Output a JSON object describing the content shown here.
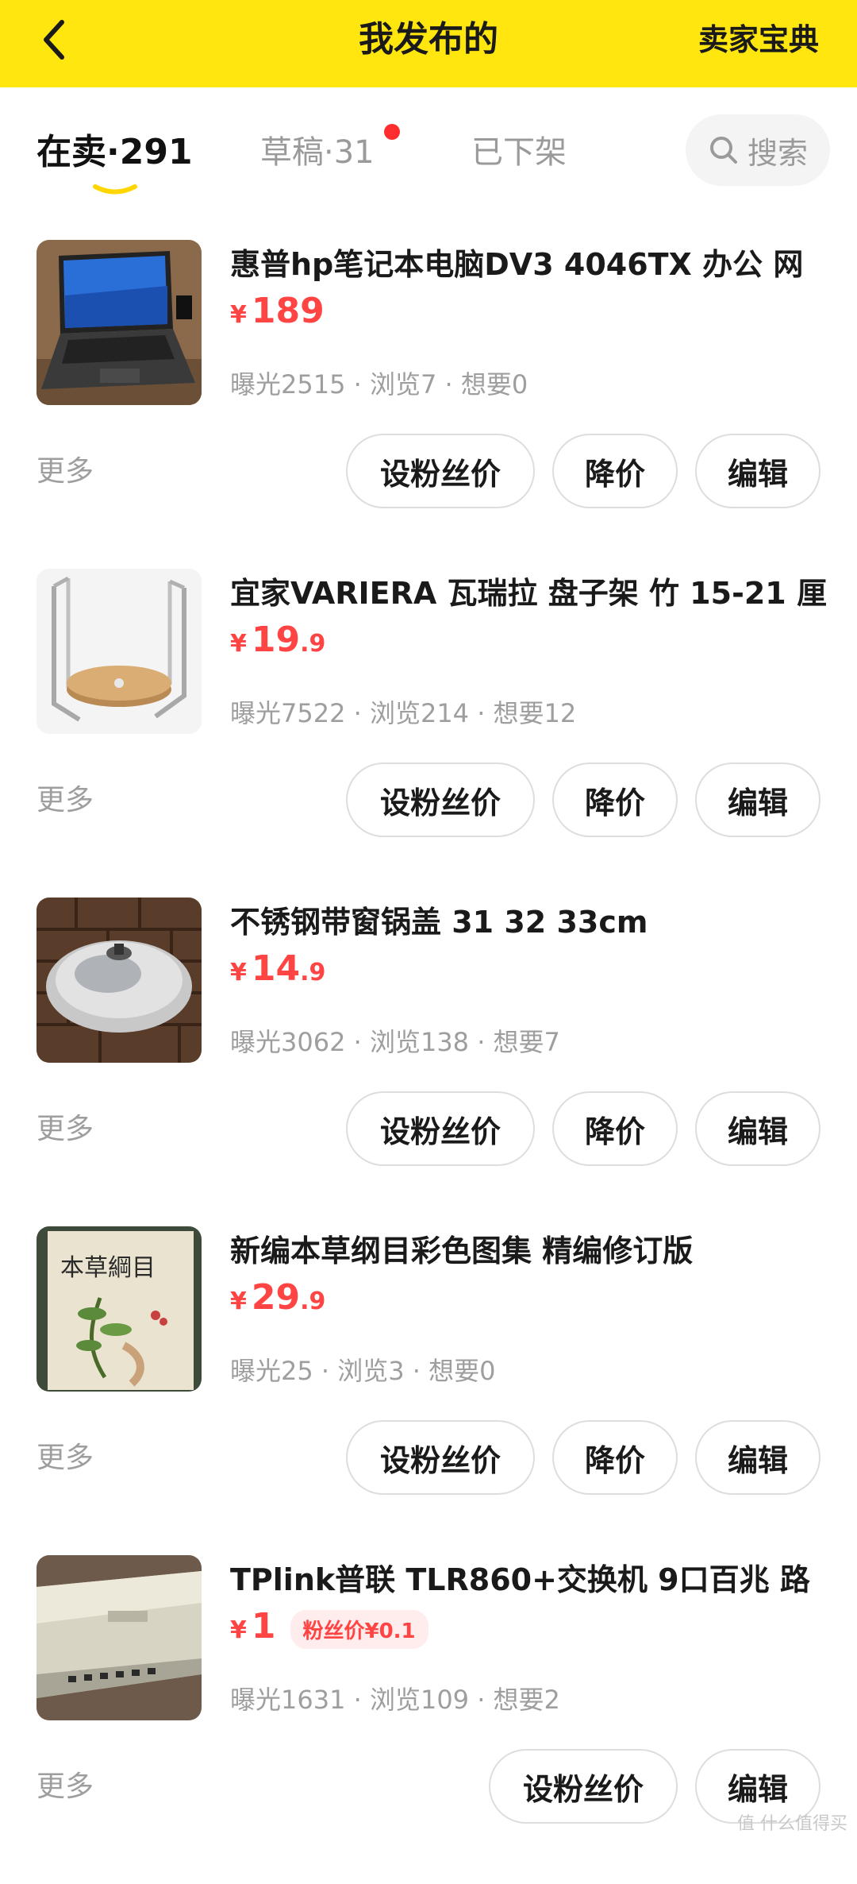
{
  "header": {
    "title": "我发布的",
    "right_link": "卖家宝典",
    "bg_color": "#FFE60F",
    "back_icon": "chevron-left-icon"
  },
  "tabs": {
    "on_sale": "在卖·291",
    "drafts": "草稿·31",
    "off_shelf": "已下架",
    "search_label": "搜索"
  },
  "colors": {
    "price": "#FF4444",
    "dot": "#FF2D2D"
  },
  "items": [
    {
      "title": "惠普hp笔记本电脑DV3 4046TX 办公 网",
      "price_int": "189",
      "price_dec": "",
      "stats": "曝光2515 · 浏览7 · 想要0",
      "more": "更多",
      "btn_fans": "设粉丝价",
      "btn_drop": "降价",
      "btn_edit": "编辑"
    },
    {
      "title": "宜家VARIERA 瓦瑞拉 盘子架 竹 15-21 厘",
      "price_int": "19",
      "price_dec": ".9",
      "stats": "曝光7522 · 浏览214 · 想要12",
      "more": "更多",
      "btn_fans": "设粉丝价",
      "btn_drop": "降价",
      "btn_edit": "编辑"
    },
    {
      "title": "不锈钢带窗锅盖 31 32 33cm",
      "price_int": "14",
      "price_dec": ".9",
      "stats": "曝光3062 · 浏览138 · 想要7",
      "more": "更多",
      "btn_fans": "设粉丝价",
      "btn_drop": "降价",
      "btn_edit": "编辑"
    },
    {
      "title": "新编本草纲目彩色图集 精编修订版",
      "price_int": "29",
      "price_dec": ".9",
      "stats": "曝光25 · 浏览3 · 想要0",
      "more": "更多",
      "btn_fans": "设粉丝价",
      "btn_drop": "降价",
      "btn_edit": "编辑",
      "cover_text": "本草綱目"
    },
    {
      "title": "TPlink普联 TLR860+交换机 9口百兆 路",
      "price_int": "1",
      "price_dec": "",
      "fan_badge": "粉丝价¥0.1",
      "stats": "曝光1631 · 浏览109 · 想要2",
      "more": "更多",
      "btn_fans": "设粉丝价",
      "btn_edit": "编辑"
    }
  ],
  "currency": "¥",
  "watermark": "值 什么值得买"
}
